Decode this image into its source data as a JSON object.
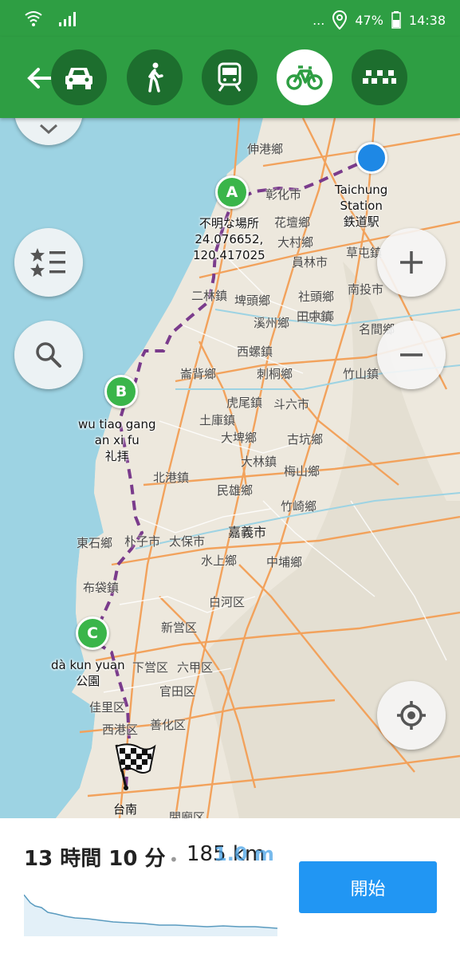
{
  "status": {
    "dots": "...",
    "battery": "47%",
    "time": "14:38"
  },
  "toolbar": {
    "modes": [
      {
        "name": "car",
        "active": false
      },
      {
        "name": "walk",
        "active": false
      },
      {
        "name": "transit",
        "active": false
      },
      {
        "name": "bike",
        "active": true
      },
      {
        "name": "taxi",
        "active": false
      }
    ]
  },
  "map": {
    "places": [
      {
        "id": "shengang",
        "text": "伸港鄉"
      },
      {
        "id": "changhua",
        "text": "彰化市"
      },
      {
        "id": "huatan",
        "text": "花壇鄉"
      },
      {
        "id": "dacun",
        "text": "大村鄉"
      },
      {
        "id": "yuanlin",
        "text": "員林市"
      },
      {
        "id": "caotun",
        "text": "草屯鎮"
      },
      {
        "id": "nantou",
        "text": "南投市"
      },
      {
        "id": "shetou",
        "text": "社頭鄉"
      },
      {
        "id": "ershui",
        "text": "二水鄉"
      },
      {
        "id": "erlin",
        "text": "二林鎮"
      },
      {
        "id": "pitou",
        "text": "埤頭鄉"
      },
      {
        "id": "tianzhong",
        "text": "田中鎮"
      },
      {
        "id": "xizhou",
        "text": "溪州鄉"
      },
      {
        "id": "mingjian",
        "text": "名間鄉"
      },
      {
        "id": "xiluo",
        "text": "西螺鎮"
      },
      {
        "id": "zhushan",
        "text": "竹山鎮"
      },
      {
        "id": "mailiao",
        "text": "崙背鄉"
      },
      {
        "id": "citong",
        "text": "刺桐鄉"
      },
      {
        "id": "huwei",
        "text": "虎尾鎮"
      },
      {
        "id": "douliu",
        "text": "斗六市"
      },
      {
        "id": "tuku",
        "text": "土庫鎮"
      },
      {
        "id": "gukeng",
        "text": "古坑鄉"
      },
      {
        "id": "dapi",
        "text": "大埤鄉"
      },
      {
        "id": "dalin",
        "text": "大林鎮"
      },
      {
        "id": "beigang",
        "text": "北港鎮"
      },
      {
        "id": "meishan",
        "text": "梅山鄉"
      },
      {
        "id": "minxiong",
        "text": "民雄鄉"
      },
      {
        "id": "zhuqi",
        "text": "竹崎鄉"
      },
      {
        "id": "chiayi",
        "text": "嘉義市"
      },
      {
        "id": "dongshi",
        "text": "東石鄉"
      },
      {
        "id": "puzi",
        "text": "朴子市"
      },
      {
        "id": "taibao",
        "text": "太保市"
      },
      {
        "id": "shuishang",
        "text": "水上鄉"
      },
      {
        "id": "zhongpu",
        "text": "中埔鄉"
      },
      {
        "id": "budai",
        "text": "布袋鎮"
      },
      {
        "id": "baihe",
        "text": "白河区"
      },
      {
        "id": "xinying",
        "text": "新営区"
      },
      {
        "id": "xiaying",
        "text": "下営区"
      },
      {
        "id": "liujia",
        "text": "六甲区"
      },
      {
        "id": "guantian",
        "text": "官田区"
      },
      {
        "id": "jiali",
        "text": "佳里区"
      },
      {
        "id": "xigang",
        "text": "西港区"
      },
      {
        "id": "shanhua",
        "text": "善化区"
      },
      {
        "id": "tainan",
        "text": "台南"
      },
      {
        "id": "guanmiao",
        "text": "関廟区"
      }
    ],
    "start": {
      "line1": "Taichung",
      "line2": "Station",
      "line3": "鉄道駅"
    },
    "waypoints": [
      {
        "letter": "A",
        "line1": "不明な場所",
        "line2": "24.076652,",
        "line3": "120.417025"
      },
      {
        "letter": "B",
        "line1": "wu tiao gang",
        "line2": "an xi fu",
        "line3": "礼拝"
      },
      {
        "letter": "C",
        "line1": "dà kun yuan",
        "line2": "公園",
        "line3": ""
      }
    ]
  },
  "summary": {
    "duration": "13 時間 10 分",
    "separator": "•",
    "distance": "185 km",
    "distance_overlay": "1.0 m",
    "start_label": "開始"
  },
  "colors": {
    "green": "#2e9e43",
    "route": "#7a3b8c",
    "sea": "#9dd3e3",
    "button": "#2196f3"
  }
}
